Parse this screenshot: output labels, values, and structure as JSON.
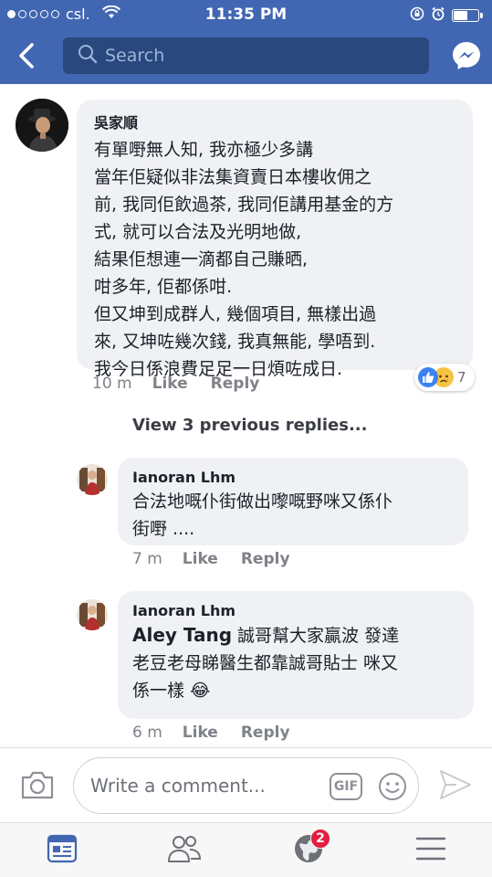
{
  "status_bar": {
    "carrier": "csl.",
    "time": "11:35 PM"
  },
  "search": {
    "placeholder": "Search"
  },
  "comments": [
    {
      "author": "吳家順",
      "lines": [
        "有單嘢無人知, 我亦極少多講",
        "當年佢疑似非法集資賣日本樓收佣之",
        "前, 我同佢飲過茶, 我同佢講用基金的方",
        "式, 就可以合法及光明地做,",
        "結果佢想連一滴都自己賺晒,",
        "咁多年, 佢都係咁.",
        "但又坤到成群人, 幾個項目, 無樣出過",
        "來, 又坤咗幾次錢, 我真無能, 學唔到.",
        "我今日係浪費足足一日煩咗成日."
      ],
      "time": "10 m",
      "like": "Like",
      "reply": "Reply",
      "reaction_count": "7"
    }
  ],
  "view_previous": "View 3 previous replies...",
  "replies": [
    {
      "author": "Ianoran Lhm",
      "lines": [
        "合法地嘅仆街做出嚟嘅野咪又係仆",
        "街嘢 ...."
      ],
      "time": "7 m",
      "like": "Like",
      "reply": "Reply"
    },
    {
      "author": "Ianoran Lhm",
      "mention": "Aley Tang",
      "line1_rest": " 誠哥幫大家贏波 發達",
      "line2": "老豆老母睇醫生都靠誠哥貼士 咪又",
      "line3": "係一樣",
      "emoji": "😂",
      "time": "6 m",
      "like": "Like",
      "reply": "Reply"
    }
  ],
  "composer": {
    "placeholder": "Write a comment...",
    "gif_label": "GIF"
  },
  "tabbar": {
    "notifications_badge": "2"
  },
  "colors": {
    "brand_blue": "#4267b2",
    "search_bg": "#29487d",
    "bubble_bg": "#f0f1f4",
    "badge_red": "#e41e3f"
  },
  "icons": [
    "wifi-icon",
    "lock-rotation-icon",
    "alarm-icon",
    "battery-icon",
    "back-chevron-icon",
    "search-icon",
    "messenger-icon",
    "camera-icon",
    "gif-icon",
    "smiley-icon",
    "send-icon",
    "news-feed-icon",
    "friends-icon",
    "notifications-globe-icon",
    "menu-icon"
  ]
}
